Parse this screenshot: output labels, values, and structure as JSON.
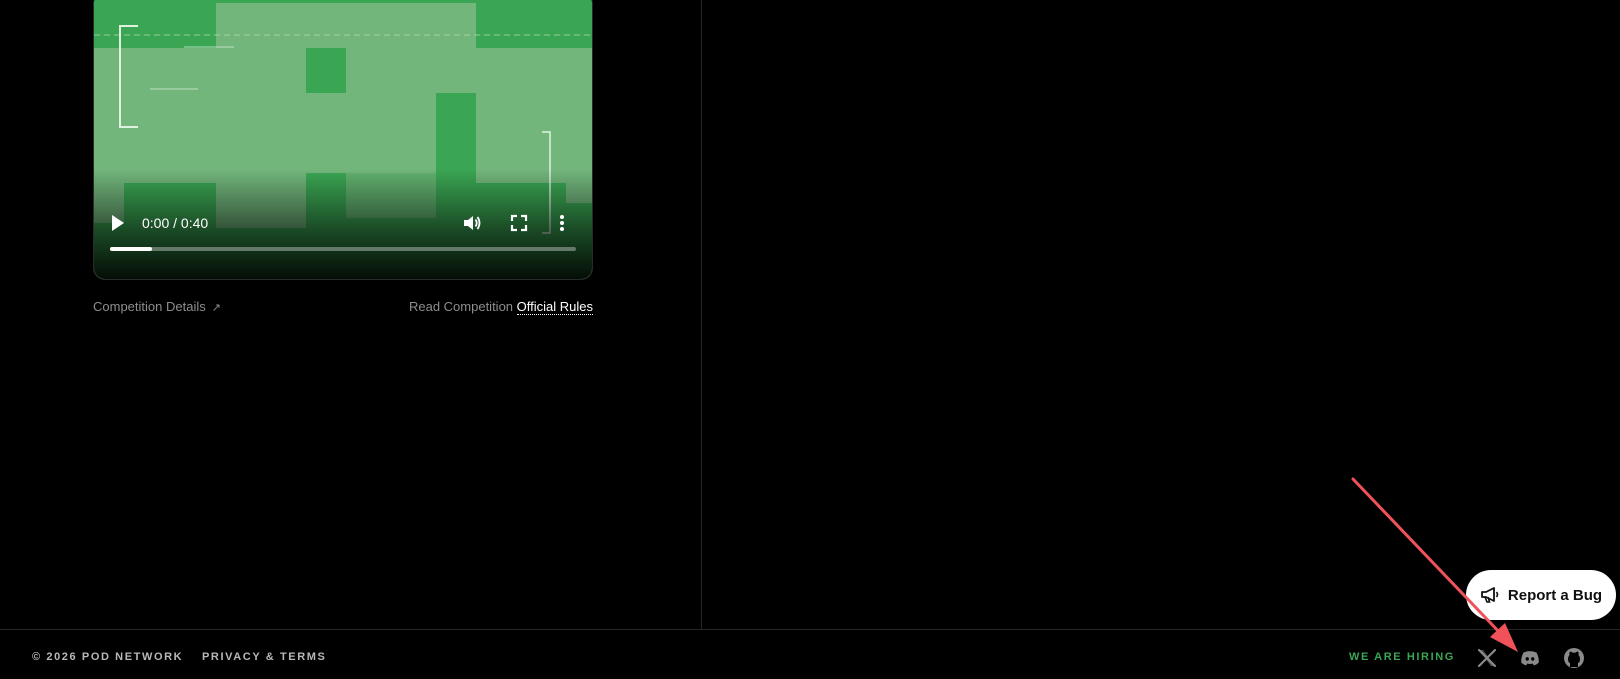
{
  "video": {
    "time": "0:00 / 0:40",
    "progress": 0.09,
    "icons": [
      "play-icon",
      "volume-icon",
      "fullscreen-icon",
      "more-options-icon"
    ]
  },
  "links": {
    "competition_details": "Competition Details",
    "competition_details_arrow": "↗",
    "read_competition": "Read Competition",
    "official_rules": "Official Rules"
  },
  "report_bug": {
    "label": "Report a Bug",
    "icon": "megaphone-icon"
  },
  "footer": {
    "copyright": "© 2026 POD NETWORK",
    "privacy": "PRIVACY & TERMS",
    "hiring": "WE ARE HIRING",
    "social_icons": [
      "x-icon",
      "discord-icon",
      "github-icon"
    ]
  },
  "colors": {
    "background": "#000000",
    "accent_green": "#3aa653",
    "pixel_light": "#72b67c",
    "annotation_red": "#f0525a"
  }
}
